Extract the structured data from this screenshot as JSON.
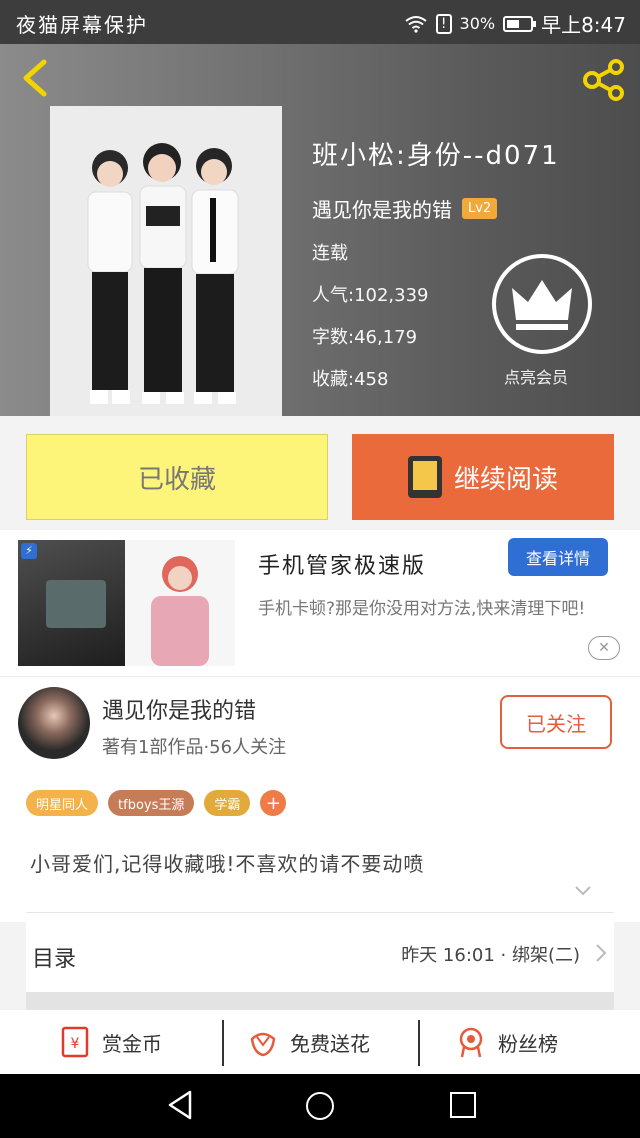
{
  "status_bar": {
    "left_text": "夜猫屏幕保护",
    "signal_warning": "!",
    "battery": "30%",
    "time": "早上8:47"
  },
  "header": {
    "back_icon": "chevron-left-icon",
    "share_icon": "share-icon"
  },
  "book": {
    "title": "班小松:身份--d071",
    "author": "遇见你是我的错",
    "level_badge": "Lv2",
    "status": "连载",
    "popularity_label": "人气:",
    "popularity": "102,339",
    "words_label": "字数:",
    "words": "46,179",
    "favorites_label": "收藏:",
    "favorites": "458",
    "crown_label": "点亮会员"
  },
  "buttons": {
    "collected": "已收藏",
    "continue_reading": "继续阅读"
  },
  "ad": {
    "title": "手机管家极速版",
    "description": "手机卡顿?那是你没用对方法,快来清理下吧!",
    "cta": "查看详情",
    "close": "✕"
  },
  "author": {
    "name": "遇见你是我的错",
    "stats": "著有1部作品·56人关注",
    "follow": "已关注"
  },
  "tags": [
    "明星同人",
    "tfboys王源",
    "学霸"
  ],
  "tag_add": "+",
  "description": "小哥爱们,记得收藏哦!不喜欢的请不要动喷",
  "catalog": {
    "label": "目录",
    "update": "昨天 16:01 · 绑架(二)"
  },
  "actions": [
    {
      "icon": "red-envelope-icon",
      "label": "赏金币"
    },
    {
      "icon": "flower-icon",
      "label": "免费送花"
    },
    {
      "icon": "medal-icon",
      "label": "粉丝榜"
    }
  ],
  "colors": {
    "accent_orange": "#ea6a3c",
    "collect_yellow": "#fdf47a",
    "ad_blue": "#2f6fd3"
  }
}
